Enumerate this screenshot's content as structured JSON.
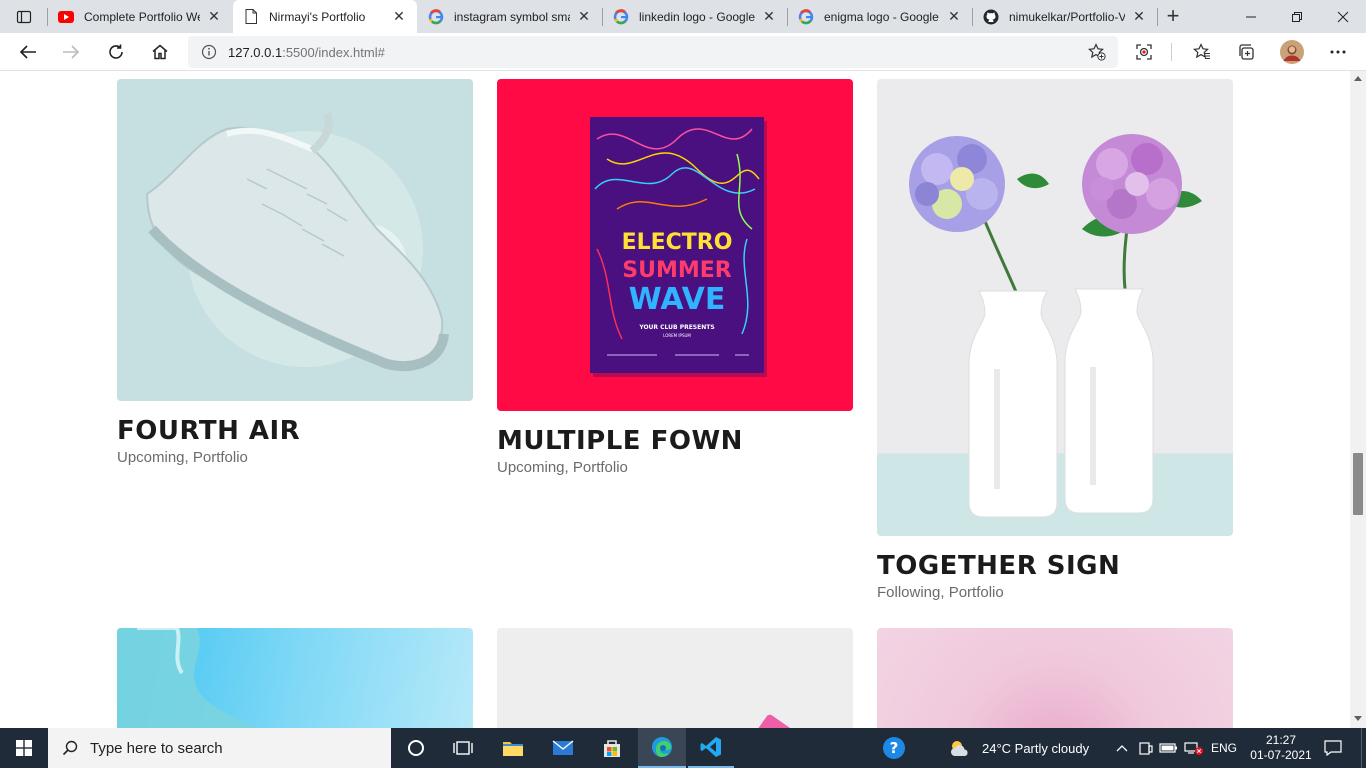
{
  "browser": {
    "tabs": [
      {
        "title": "Complete Portfolio We",
        "favicon": "youtube-icon",
        "active": false
      },
      {
        "title": "Nirmayi's Portfolio",
        "favicon": "page-icon",
        "active": true
      },
      {
        "title": "instagram symbol sma",
        "favicon": "google-icon",
        "active": false
      },
      {
        "title": "linkedin logo - Google",
        "favicon": "google-icon",
        "active": false
      },
      {
        "title": "enigma logo - Google",
        "favicon": "google-icon",
        "active": false
      },
      {
        "title": "nimukelkar/Portfolio-V",
        "favicon": "github-icon",
        "active": false
      }
    ],
    "url_host": "127.0.0.1",
    "url_rest": ":5500/index.html#"
  },
  "portfolio": {
    "cards": [
      {
        "title": "FOURTH AIR",
        "subtitle": "Upcoming, Portfolio"
      },
      {
        "title": "MULTIPLE FOWN",
        "subtitle": "Upcoming, Portfolio"
      },
      {
        "title": "TOGETHER SIGN",
        "subtitle": "Following, Portfolio"
      }
    ],
    "poster": {
      "line1": "ELECTRO",
      "line2": "SUMMER",
      "line3": "WAVE",
      "line4": "YOUR CLUB PRESENTS",
      "line5": "LOREM IPSUM"
    }
  },
  "taskbar": {
    "search_placeholder": "Type here to search",
    "weather": "24°C  Partly cloudy",
    "language": "ENG",
    "time": "21:27",
    "date": "01-07-2021"
  },
  "colors": {
    "poster_bg": "#ff0a45",
    "shoe_bg": "#c6dfe0",
    "vase_bg": "#eaeaec",
    "taskbar": "#1f2b38"
  }
}
